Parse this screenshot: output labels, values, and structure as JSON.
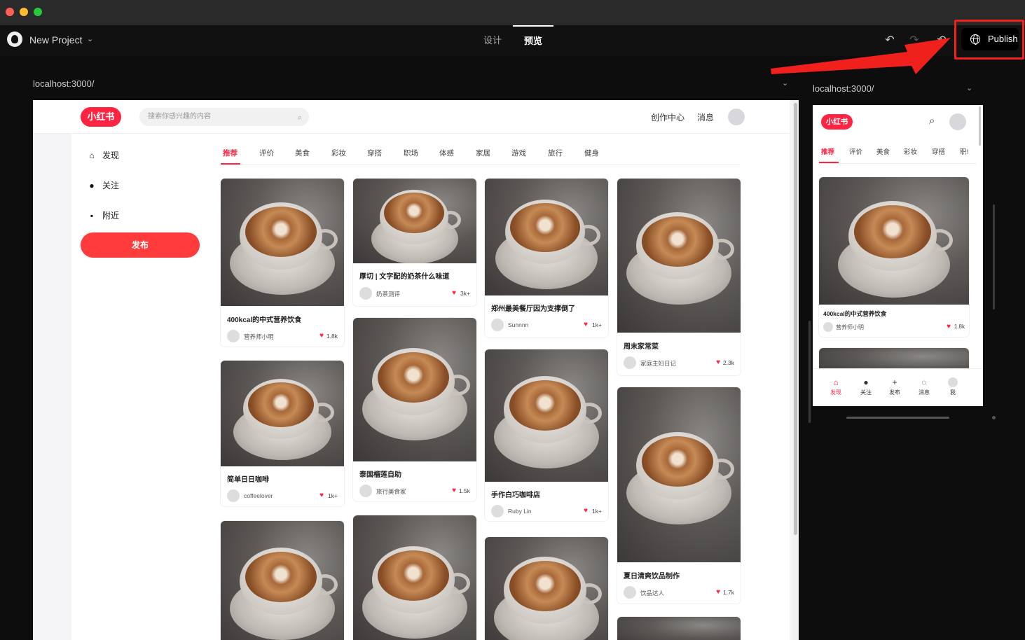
{
  "project": {
    "name": "New Project"
  },
  "modes": {
    "design": "设计",
    "preview": "预览"
  },
  "toolbar": {
    "publish_label": "Publish"
  },
  "desktop": {
    "address": "localhost:3000/",
    "logo": "小红书",
    "search_placeholder": "搜索你感兴趣的内容",
    "header_links": [
      "创作中心",
      "消息"
    ],
    "sidebar": {
      "items": [
        "发现",
        "关注",
        "附近"
      ],
      "publish": "发布"
    },
    "categories": [
      "推荐",
      "评价",
      "美食",
      "彩妆",
      "穿搭",
      "职场",
      "体感",
      "家居",
      "游戏",
      "旅行",
      "健身"
    ],
    "cards": [
      {
        "title": "400kcal的中式营养饮食",
        "author": "营养师小明",
        "likes": "1.8k"
      },
      {
        "title": "简单日日咖啡",
        "author": "coffeelover",
        "likes": "1k+"
      },
      {
        "title": "",
        "author": "",
        "likes": ""
      },
      {
        "title": "厚切 | 文字配的奶茶什么味道",
        "author": "奶茶测评",
        "likes": "3k+"
      },
      {
        "title": "泰国榴莲自助",
        "author": "旅行美食家",
        "likes": "1.5k"
      },
      {
        "title": "",
        "author": "",
        "likes": ""
      },
      {
        "title": "郑州最美餐厅因为支撑倒了",
        "author": "Sunnnn",
        "likes": "1k+"
      },
      {
        "title": "手作白巧咖啡店",
        "author": "Ruby Lin",
        "likes": "1k+"
      },
      {
        "title": "",
        "author": "",
        "likes": ""
      },
      {
        "title": "周末家常菜",
        "author": "家庭主妇日记",
        "likes": "2.3k"
      },
      {
        "title": "夏日清爽饮品制作",
        "author": "饮品达人",
        "likes": "1.7k"
      },
      {
        "title": "",
        "author": "",
        "likes": ""
      }
    ]
  },
  "mobile": {
    "address": "localhost:3000/",
    "logo": "小红书",
    "categories": [
      "推荐",
      "评价",
      "美食",
      "彩妆",
      "穿搭",
      "职!"
    ],
    "card": {
      "title": "400kcal的中式营养饮食",
      "author": "营养师小明",
      "likes": "1.8k"
    },
    "tabbar": [
      "发现",
      "关注",
      "发布",
      "消息",
      "我"
    ]
  },
  "colors": {
    "brand": "#ff2442",
    "publish_highlight": "#f0201c"
  }
}
